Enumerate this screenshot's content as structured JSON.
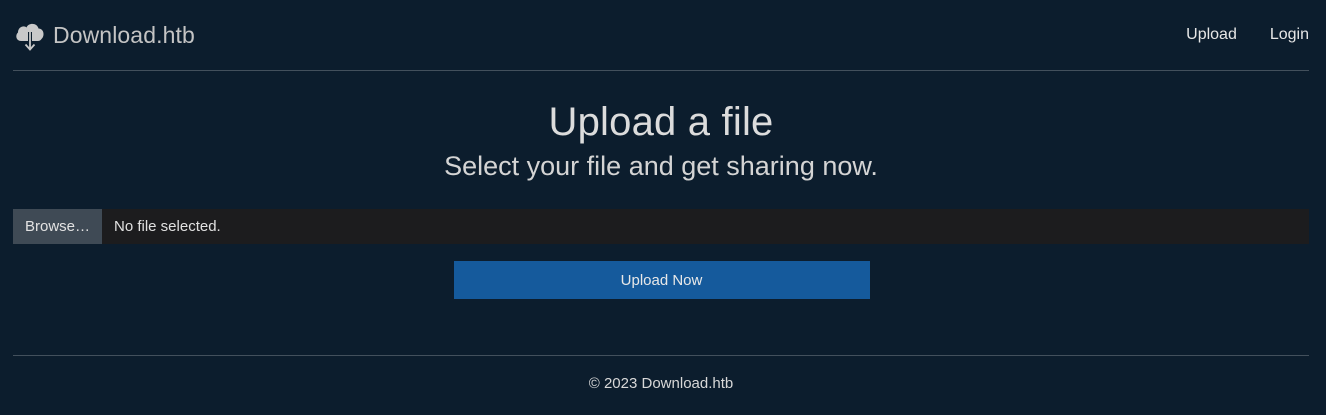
{
  "brand": {
    "name": "Download.htb",
    "icon": "cloud-download-icon"
  },
  "nav": {
    "items": [
      {
        "label": "Upload"
      },
      {
        "label": "Login"
      }
    ]
  },
  "hero": {
    "title": "Upload a file",
    "subtitle": "Select your file and get sharing now."
  },
  "file_input": {
    "browse_label": "Browse…",
    "status": "No file selected."
  },
  "upload_button": {
    "label": "Upload Now"
  },
  "footer": {
    "text": "© 2023 Download.htb"
  },
  "colors": {
    "background": "#0c1d2d",
    "primary_button": "#155a9c",
    "browse_button": "#3f4a55",
    "file_field": "#1c1c1e"
  }
}
